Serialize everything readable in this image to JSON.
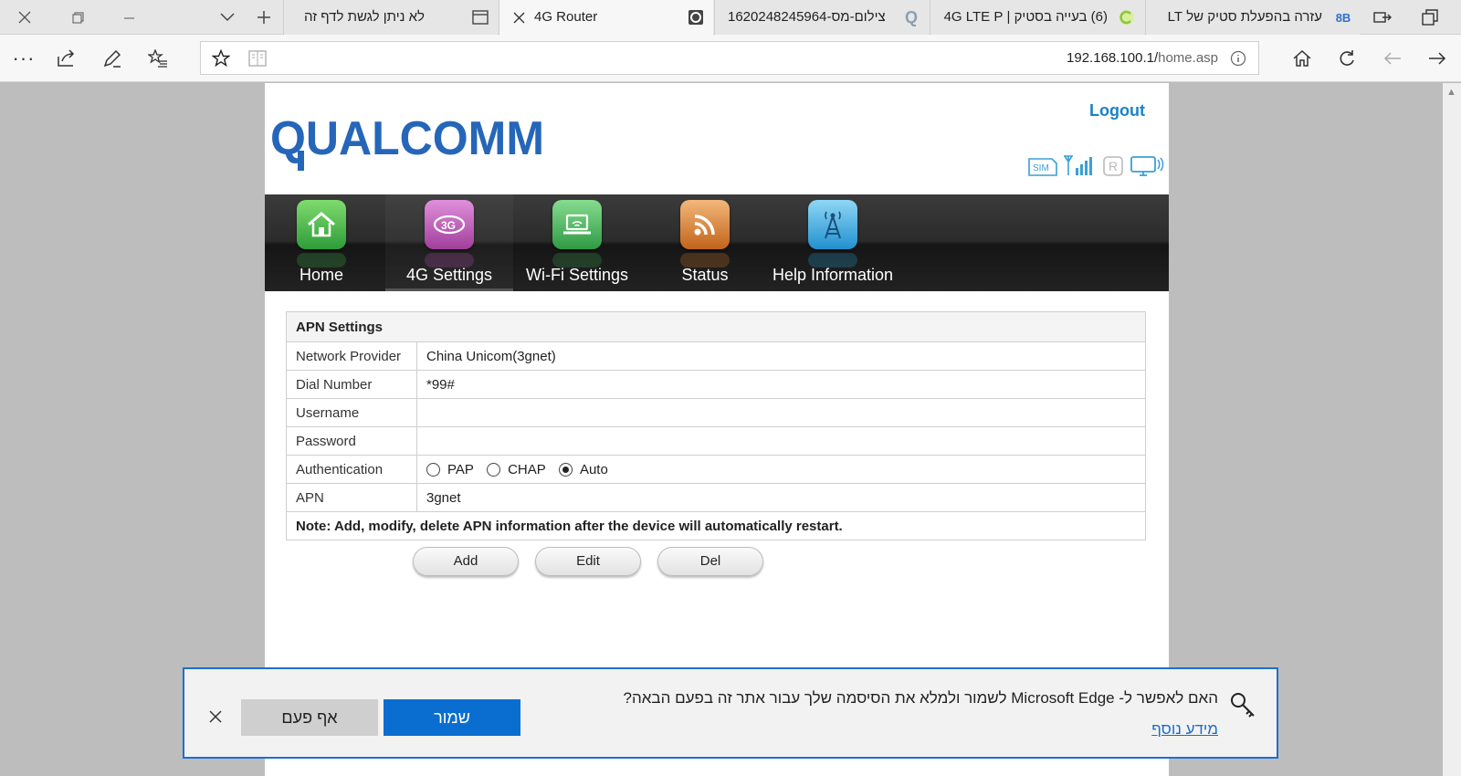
{
  "browser": {
    "tabs": [
      {
        "title": "עזרה בהפעלת סטיק של LT",
        "favicon_text": "8B",
        "favicon_color": "#2d6fcf"
      },
      {
        "title": "(6) בעייה בסטיק | 4G LTE P",
        "favicon_text": "",
        "favicon_color": "#8cc63f"
      },
      {
        "title": "צילום-מס-1620248245964",
        "favicon_text": "Q",
        "favicon_color": "#8aa0b0"
      },
      {
        "title": "4G Router",
        "favicon_text": "",
        "favicon_color": "#444444"
      },
      {
        "title": "לא ניתן לגשת לדף זה",
        "favicon_text": "",
        "favicon_color": "#555555"
      }
    ],
    "address": {
      "host": "192.168.100.1/",
      "path": "home.asp"
    }
  },
  "router": {
    "logo_text": "QUALCOMM",
    "logout_label": "Logout",
    "status_icons": [
      "sim-icon",
      "signal-icon",
      "roaming-icon",
      "connection-icon"
    ],
    "sim_label": "SIM",
    "roaming_label": "R",
    "menu": [
      {
        "label": "Home",
        "color": "#3fb64a",
        "icon": "home-icon"
      },
      {
        "label": "4G Settings",
        "color": "#b94fb1",
        "icon": "4g-icon"
      },
      {
        "label": "Wi-Fi Settings",
        "color": "#3dab52",
        "icon": "wifi-laptop-icon"
      },
      {
        "label": "Status",
        "color": "#d97f2a",
        "icon": "rss-icon"
      },
      {
        "label": "Help Information",
        "color": "#2aa7dc",
        "icon": "tower-icon"
      }
    ],
    "apn": {
      "title": "APN Settings",
      "rows": [
        {
          "label": "Network Provider",
          "value": "China Unicom(3gnet)"
        },
        {
          "label": "Dial Number",
          "value": "*99#"
        },
        {
          "label": "Username",
          "value": ""
        },
        {
          "label": "Password",
          "value": ""
        }
      ],
      "auth_label": "Authentication",
      "auth_options": [
        "PAP",
        "CHAP",
        "Auto"
      ],
      "auth_selected": "Auto",
      "apn_label": "APN",
      "apn_value": "3gnet",
      "note": "Note: Add, modify, delete APN information after the device will automatically restart."
    },
    "buttons": {
      "add": "Add",
      "edit": "Edit",
      "del": "Del"
    }
  },
  "savebar": {
    "question": "האם לאפשר ל- Microsoft Edge לשמור ולמלא את הסיסמה שלך עבור אתר זה בפעם הבאה?",
    "more": "מידע נוסף",
    "save_label": "שמור",
    "never_label": "אף פעם"
  }
}
